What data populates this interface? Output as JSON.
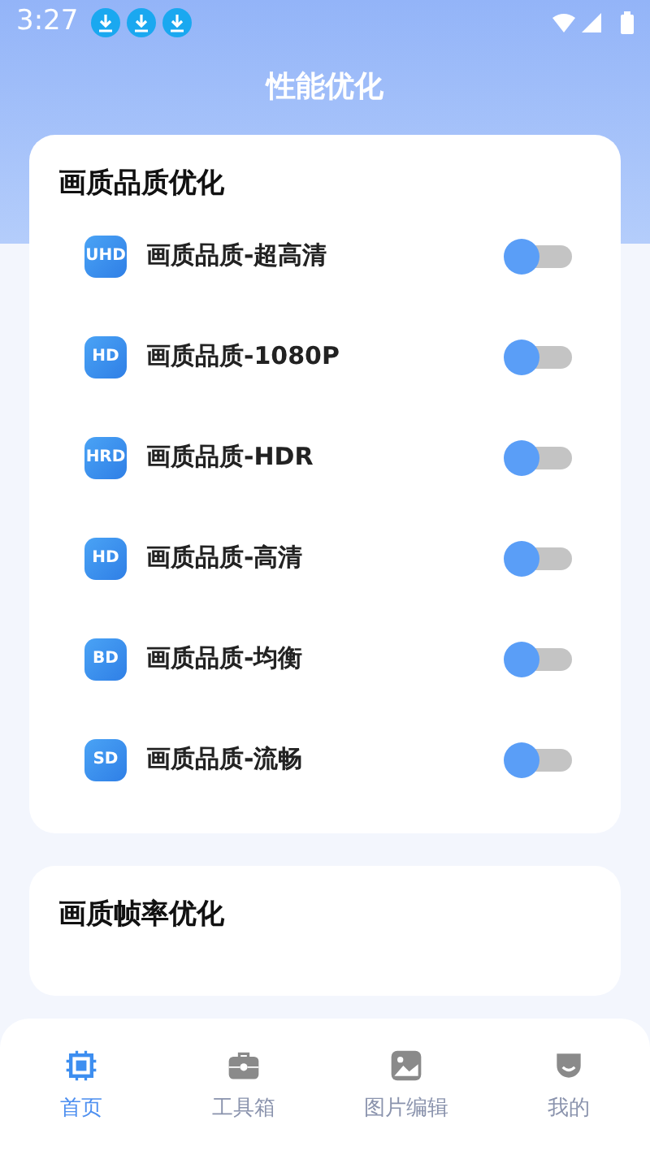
{
  "status_bar": {
    "time": "3:27",
    "notifications": [
      {
        "kind": "download"
      },
      {
        "kind": "download"
      },
      {
        "kind": "download"
      }
    ]
  },
  "header": {
    "title": "性能优化"
  },
  "sections": [
    {
      "title": "画质品质优化",
      "items": [
        {
          "badge": "UHD",
          "label": "画质品质-超高清",
          "on": false
        },
        {
          "badge": "HD",
          "label": "画质品质-1080P",
          "on": false
        },
        {
          "badge": "HRD",
          "label": "画质品质-HDR",
          "on": false
        },
        {
          "badge": "HD",
          "label": "画质品质-高清",
          "on": false
        },
        {
          "badge": "BD",
          "label": "画质品质-均衡",
          "on": false
        },
        {
          "badge": "SD",
          "label": "画质品质-流畅",
          "on": false
        }
      ]
    },
    {
      "title": "画质帧率优化"
    }
  ],
  "bottom_nav": [
    {
      "label": "首页",
      "kind": "chip",
      "selected": true
    },
    {
      "label": "工具箱",
      "kind": "toolbox",
      "selected": false
    },
    {
      "label": "图片编辑",
      "kind": "image",
      "selected": false
    },
    {
      "label": "我的",
      "kind": "profile",
      "selected": false
    }
  ]
}
